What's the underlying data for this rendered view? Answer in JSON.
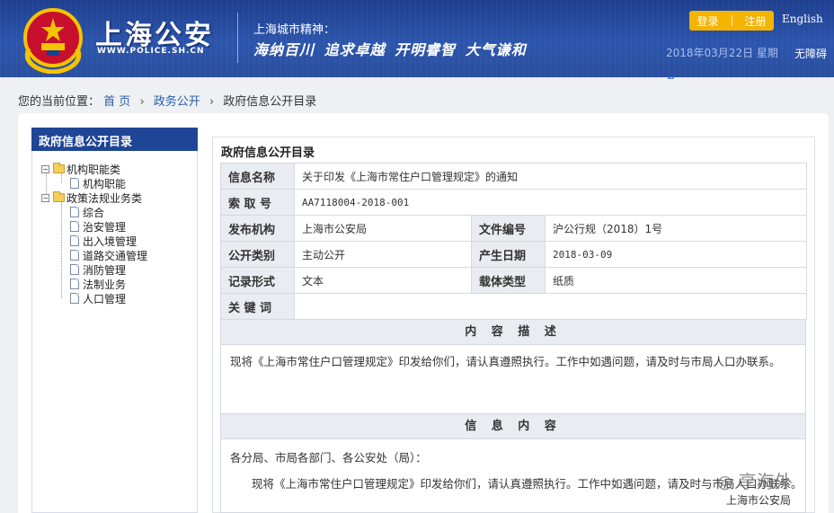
{
  "header": {
    "site_title": "上海公安",
    "site_url": "WWW.POLICE.SH.CN",
    "spirit_title": "上海城市精神：",
    "slogans": "海纳百川 追求卓越 开明睿智 大气谦和",
    "login_label": "登录",
    "register_label": "注册",
    "language_label": "English",
    "date_text": "2018年03月22日 星期",
    "accessibility_label": "无障碍",
    "brand_color": "#2c55ac",
    "accent_color": "#f4b400"
  },
  "breadcrumb": {
    "prefix": "您的当前位置：",
    "items": [
      "首 页",
      "政务公开",
      "政府信息公开目录"
    ],
    "separator": "›"
  },
  "sidebar": {
    "title": "政府信息公开目录",
    "tree": [
      {
        "label": "机构职能类",
        "children": [
          "机构职能"
        ]
      },
      {
        "label": "政策法规业务类",
        "children": [
          "综合",
          "治安管理",
          "出入境管理",
          "道路交通管理",
          "消防管理",
          "法制业务",
          "人口管理"
        ]
      }
    ]
  },
  "content": {
    "title": "政府信息公开目录",
    "fields": {
      "info_name_label": "信息名称",
      "info_name_value": "关于印发《上海市常住户口管理规定》的通知",
      "index_label": "索 取 号",
      "index_value": "AA7118004-2018-001",
      "publisher_label": "发布机构",
      "publisher_value": "上海市公安局",
      "doc_no_label": "文件编号",
      "doc_no_value": "沪公行规（2018）1号",
      "category_label": "公开类别",
      "category_value": "主动公开",
      "date_label": "产生日期",
      "date_value": "2018-03-09",
      "record_label": "记录形式",
      "record_value": "文本",
      "carrier_label": "载体类型",
      "carrier_value": "纸质",
      "keywords_label": "关 键 词",
      "keywords_value": ""
    },
    "description_head": "内 容 描 述",
    "description_text": "现将《上海市常住户口管理规定》印发给你们，请认真遵照执行。工作中如遇问题，请及时与市局人口办联系。",
    "info_head": "信 息 内 容",
    "info_salutation": "各分局、市局各部门、各公安处（局）：",
    "info_body": "现将《上海市常住户口管理规定》印发给你们，请认真遵照执行。工作中如遇问题，请及时与市局人口办联系。",
    "watermark": "◎ 享海外",
    "signature": "上海市公安局"
  }
}
